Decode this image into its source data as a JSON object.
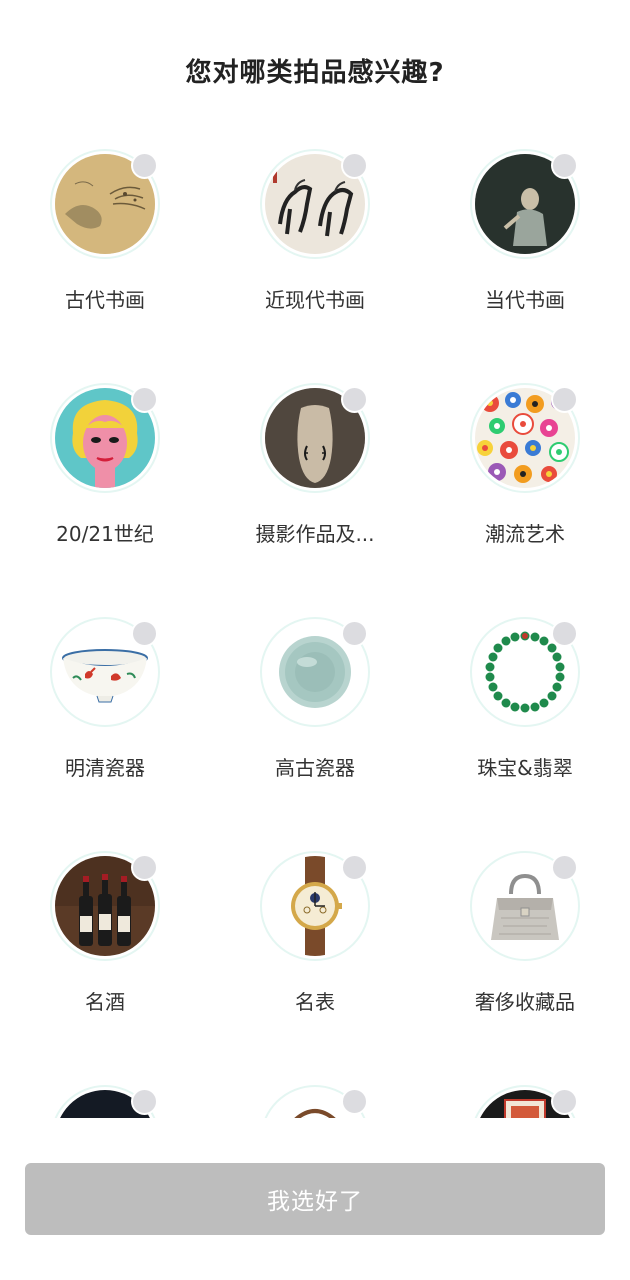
{
  "header": {
    "title": "您对哪类拍品感兴趣?"
  },
  "categories": [
    {
      "label": "古代书画",
      "image": "ancient-painting-thumbnail",
      "selected": false
    },
    {
      "label": "近现代书画",
      "image": "modern-horse-painting-thumbnail",
      "selected": false
    },
    {
      "label": "当代书画",
      "image": "contemporary-painting-thumbnail",
      "selected": false
    },
    {
      "label": "20/21世纪",
      "image": "pop-art-portrait-thumbnail",
      "selected": false
    },
    {
      "label": "摄影作品及...",
      "image": "photography-thumbnail",
      "selected": false
    },
    {
      "label": "潮流艺术",
      "image": "flower-pattern-thumbnail",
      "selected": false
    },
    {
      "label": "明清瓷器",
      "image": "porcelain-bowl-thumbnail",
      "selected": false
    },
    {
      "label": "高古瓷器",
      "image": "celadon-bowl-thumbnail",
      "selected": false
    },
    {
      "label": "珠宝&翡翠",
      "image": "jade-necklace-thumbnail",
      "selected": false
    },
    {
      "label": "名酒",
      "image": "wine-bottles-thumbnail",
      "selected": false
    },
    {
      "label": "名表",
      "image": "watch-thumbnail",
      "selected": false
    },
    {
      "label": "奢侈收藏品",
      "image": "handbag-thumbnail",
      "selected": false
    },
    {
      "label": "",
      "image": "dark-thumbnail-partial",
      "selected": false
    },
    {
      "label": "",
      "image": "chair-thumbnail-partial",
      "selected": false
    },
    {
      "label": "",
      "image": "stamp-thumbnail-partial",
      "selected": false
    }
  ],
  "footer": {
    "confirm_label": "我选好了"
  },
  "colors": {
    "ring": "#e4f6f2",
    "check_unselected": "#dcdce0",
    "button_disabled": "#bdbdbd"
  }
}
